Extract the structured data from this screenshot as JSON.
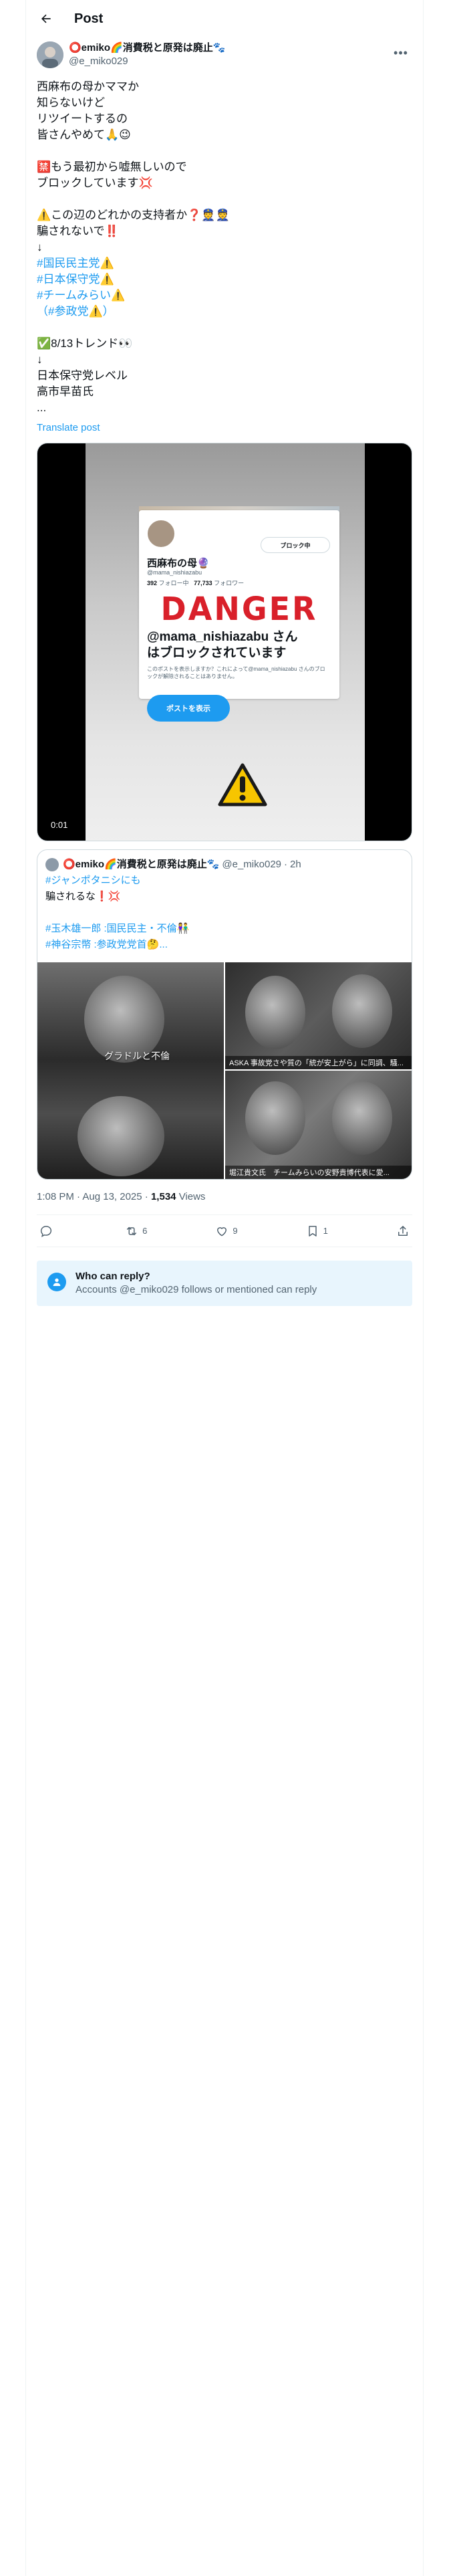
{
  "topbar": {
    "title": "Post"
  },
  "tweet": {
    "display_name": "⭕emiko🌈消費税と原発は廃止🐾",
    "handle": "@e_miko029",
    "body_lines": [
      "西麻布の母かママか",
      "知らないけど",
      "リツイートするの",
      "皆さんやめて🙏😉",
      "",
      "🈲もう最初から嘘無しいので",
      "ブロックしています💢",
      "",
      "⚠️この辺のどれかの支持者か❓👮👮",
      "騙されないで‼️",
      "↓",
      "#国民民主党⚠️",
      "#日本保守党⚠️",
      "#チームみらい⚠️",
      "（#参政党⚠️）",
      "",
      "✅8/13トレンド👀",
      "↓",
      "日本保守党レベル",
      "高市早苗氏",
      "..."
    ],
    "translate_label": "Translate post"
  },
  "video": {
    "timecode": "0:01",
    "card": {
      "follow_state": "ブロック中",
      "name": "西麻布の母🔮",
      "handle": "@mama_nishiazabu",
      "following_count": "392",
      "following_label": "フォロー中",
      "followers_count": "77,733",
      "followers_label": "フォロワー",
      "danger": "DANGER",
      "blocked_line1": "@mama_nishiazabu さん",
      "blocked_line2": "はブロックされています",
      "description": "このポストを表示しますか？これによって@mama_nishiazabu さんのブロックが解除されることはありません。",
      "post_button": "ポストを表示"
    }
  },
  "quote": {
    "display_name": "⭕emiko🌈消費税と原発は廃止🐾",
    "handle": "@e_miko029",
    "time": "2h",
    "text_lines": [
      "#ジャンポタニシにも",
      "騙されるな❗💢",
      "",
      "#玉木雄一郎 :国民民主・不倫👫",
      "#神谷宗幣 :参政党党首🤔..."
    ],
    "image_captions": {
      "left": "グラドルと不倫",
      "top_right": "ASKA 事故党さや質の「統が安上がら」に同調、騒...",
      "bottom_right": "堀江貴文氏　チームみらいの安野貴博代表に愛..."
    }
  },
  "meta": {
    "time": "1:08 PM · Aug 13, 2025",
    "views_count": "1,534",
    "views_label": "Views"
  },
  "actions": {
    "reply_count": "",
    "repost_count": "6",
    "like_count": "9",
    "bookmark_count": "1"
  },
  "reply_box": {
    "title": "Who can reply?",
    "subtitle": "Accounts @e_miko029 follows or mentioned can reply"
  },
  "colors": {
    "accent": "#1d9bf0",
    "text": "#0f1419",
    "secondary": "#536471",
    "danger": "#d9202a"
  }
}
